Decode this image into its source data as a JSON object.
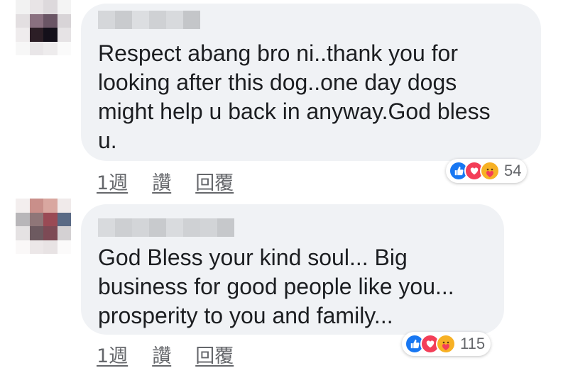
{
  "comments": [
    {
      "text_lines": [
        "Respect abang bro ni..thank you for",
        "looking after this dog..one day dogs",
        "might help u back in anyway.God bless",
        "u."
      ],
      "reaction_count": "54",
      "actions": {
        "time": "1週",
        "like": "讚",
        "reply": "回覆"
      },
      "reactions": [
        "like-icon",
        "love-icon",
        "care-icon"
      ]
    },
    {
      "text_lines": [
        "God Bless your kind soul... Big",
        "business for good people like you...",
        "prosperity to you and family..."
      ],
      "reaction_count": "115",
      "actions": {
        "time": "1週",
        "like": "讚",
        "reply": "回覆"
      },
      "reactions": [
        "like-icon",
        "love-icon",
        "care-icon"
      ]
    }
  ],
  "colors": {
    "bubble": "#f0f2f5",
    "text": "#1c1e21",
    "meta": "#65676b",
    "like": "#1877f2",
    "love": "#f33e58",
    "care": "#f7b125"
  }
}
